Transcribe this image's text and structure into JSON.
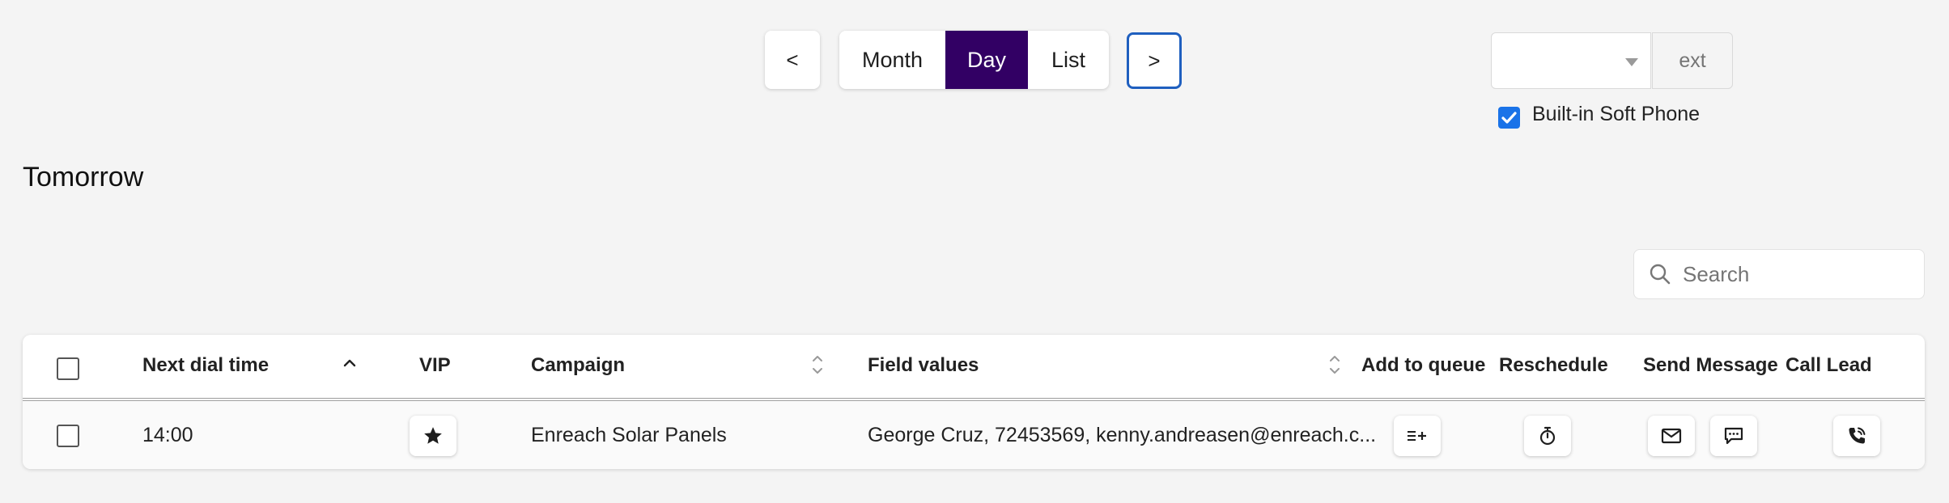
{
  "nav": {
    "prev_label": "<",
    "next_label": ">",
    "views": [
      "Month",
      "Day",
      "List"
    ],
    "active_view": "Day"
  },
  "phone": {
    "select_value": "",
    "ext_placeholder": "ext",
    "softphone_label": "Built-in Soft Phone",
    "softphone_checked": true
  },
  "section": {
    "title": "Tomorrow"
  },
  "search": {
    "placeholder": "Search"
  },
  "table": {
    "headers": {
      "next_dial_time": "Next dial time",
      "vip": "VIP",
      "campaign": "Campaign",
      "field_values": "Field values",
      "add_to_queue": "Add to queue",
      "reschedule": "Reschedule",
      "send_message": "Send Message",
      "call_lead": "Call Lead"
    },
    "rows": [
      {
        "next_dial_time": "14:00",
        "campaign": "Enreach Solar Panels",
        "field_values": "George Cruz, 72453569, kenny.andreasen@enreach.c..."
      }
    ]
  },
  "colors": {
    "accent": "#320064",
    "focus_ring": "#1f5fbf",
    "checkbox": "#1a73e8"
  }
}
